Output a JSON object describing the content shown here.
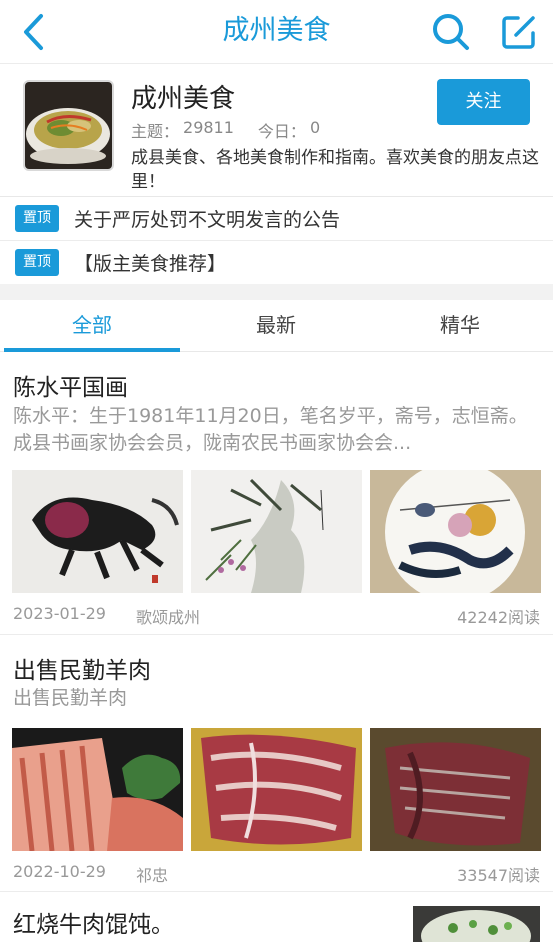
{
  "header": {
    "title": "成州美食",
    "icons": {
      "back": "chevron-left-icon",
      "search": "search-icon",
      "edit": "edit-icon"
    }
  },
  "forum": {
    "name": "成州美食",
    "topics_label": "主题：",
    "topics_value": "29811",
    "today_label": "今日：",
    "today_value": "0",
    "description": "成县美食、各地美食制作和指南。喜欢美食的朋友点这里！",
    "follow_label": "关注"
  },
  "pinned": [
    {
      "badge": "置顶",
      "text": "关于严厉处罚不文明发言的公告"
    },
    {
      "badge": "置顶",
      "text": "【版主美食推荐】"
    }
  ],
  "tabs": [
    {
      "label": "全部",
      "active": true
    },
    {
      "label": "最新",
      "active": false
    },
    {
      "label": "精华",
      "active": false
    }
  ],
  "posts": [
    {
      "title": "陈水平国画",
      "summary": "陈水平：生于1981年11月20日，笔名岁平，斋号，志恒斋。成县书画家协会会员，陇南农民书画家协会会...",
      "date": "2023-01-29",
      "author": "歌颂成州",
      "reads": "42242阅读"
    },
    {
      "title": "出售民勤羊肉",
      "summary": "出售民勤羊肉",
      "date": "2022-10-29",
      "author": "祁忠",
      "reads": "33547阅读"
    },
    {
      "title": "红烧牛肉馄饨。"
    }
  ],
  "colors": {
    "accent": "#1a9ad9",
    "muted": "#999999",
    "band": "#f2f2f2"
  }
}
